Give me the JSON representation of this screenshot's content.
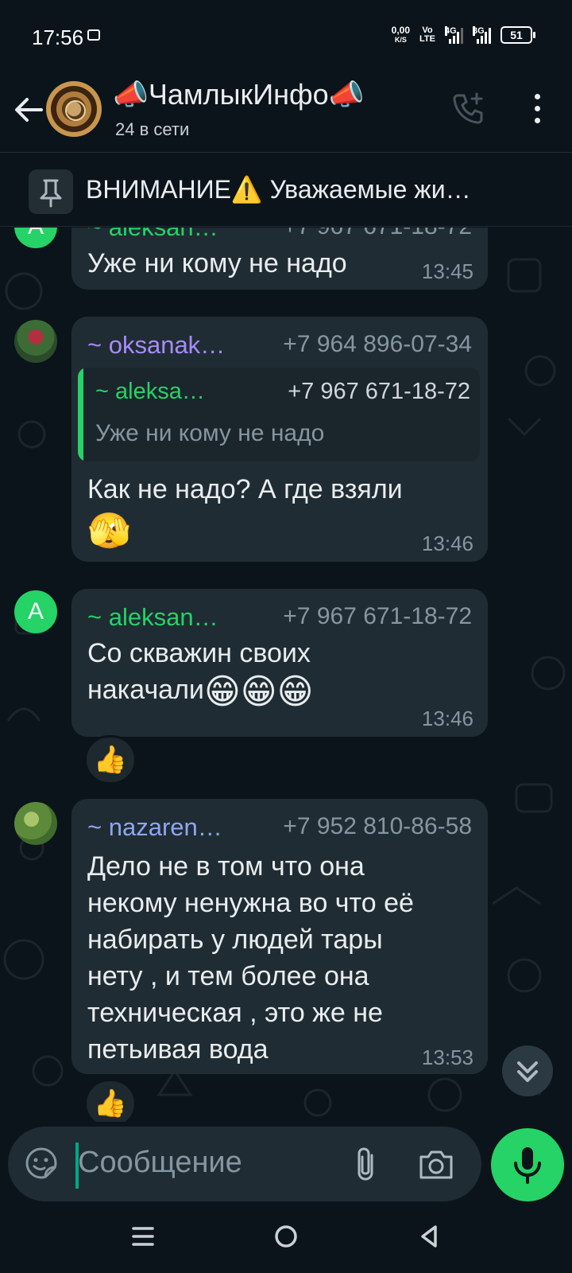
{
  "status_bar": {
    "time": "17:56",
    "net_speed_value": "0,00",
    "net_speed_unit": "K/S",
    "volte_top": "Vo",
    "volte_bottom": "LTE",
    "sim1": "4G",
    "sim2": "3G",
    "battery": "51"
  },
  "header": {
    "title": "📣ЧамлыкИнфо📣",
    "subtitle": "24 в сети"
  },
  "pinned": {
    "text": "ВНИМАНИЕ⚠️ Уважаемые жи…"
  },
  "messages": [
    {
      "sender": "~ aleksan…",
      "phone": "+7 967 671-18-72",
      "text": "Уже ни кому не надо",
      "time": "13:45"
    },
    {
      "sender": "~ oksanak…",
      "phone": "+7 964 896-07-34",
      "quote_sender": "~ aleksa…",
      "quote_phone": "+7 967 671-18-72",
      "quote_text": "Уже ни кому не надо",
      "text_line1": "Как не надо? А где взяли",
      "text_emoji": "🫣",
      "time": "13:46"
    },
    {
      "avatar_letter": "A",
      "sender": "~ aleksan…",
      "phone": "+7 967 671-18-72",
      "text_line1": "Со скважин своих",
      "text_line2": "накачали",
      "text_emoji": "😁😁😁",
      "time": "13:46",
      "reaction": "👍"
    },
    {
      "sender": "~ nazaren…",
      "phone": "+7 952 810-86-58",
      "text_lines": [
        "Дело не в том что она",
        "некому ненужна во что её",
        "набирать у людей тары",
        "нету , и тем более она",
        "техническая , это же не",
        "петьивая вода"
      ],
      "time": "13:53",
      "reaction": "👍"
    }
  ],
  "input": {
    "placeholder": "Сообщение"
  },
  "colors": {
    "background": "#0b141a",
    "bubble": "#202c33",
    "accent_green": "#25d366",
    "sender_green": "#25d366",
    "sender_purple": "#a78bfa",
    "sender_blue": "#8fa5f5",
    "timestamp": "#8696a0"
  },
  "icons": {
    "back": "arrow-left-icon",
    "call": "call-add-icon",
    "menu": "more-vert-icon",
    "pin": "pin-icon",
    "sticker": "sticker-icon",
    "attach": "paperclip-icon",
    "camera": "camera-icon",
    "mic": "mic-icon",
    "scroll": "chevron-double-down-icon"
  }
}
